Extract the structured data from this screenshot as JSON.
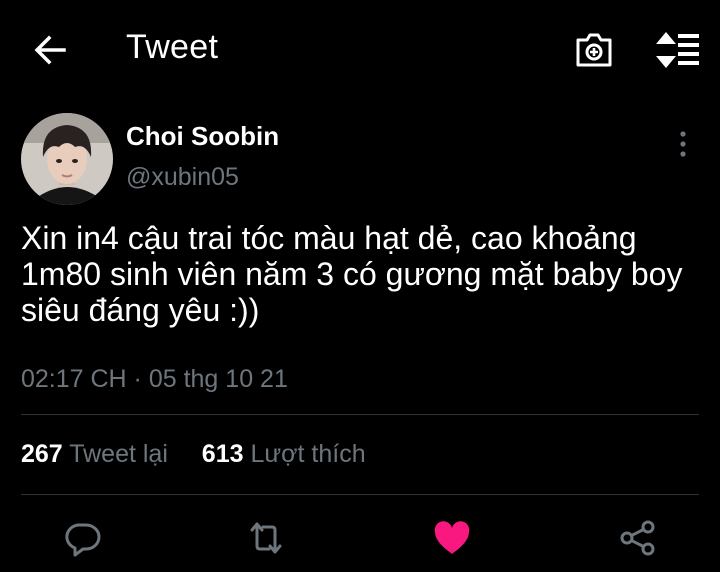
{
  "header": {
    "title": "Tweet",
    "icons": {
      "back": "arrow-left-icon",
      "camera": "camera-icon",
      "sort": "sort-icon"
    }
  },
  "author": {
    "display_name": "Choi Soobin",
    "handle": "@xubin05"
  },
  "tweet": {
    "text": "Xin in4 cậu trai tóc màu hạt dẻ, cao khoảng 1m80 sinh viên năm 3 có gương mặt baby boy siêu đáng yêu :))",
    "timestamp": "02:17 CH · 05 thg 10 21"
  },
  "stats": {
    "retweets_count": "267",
    "retweets_label": "Tweet lại",
    "likes_count": "613",
    "likes_label": "Lượt thích"
  },
  "actions": {
    "icons": [
      "reply-icon",
      "retweet-icon",
      "like-icon",
      "share-icon"
    ],
    "like_active": true,
    "like_color": "#f91880"
  },
  "colors": {
    "background": "#000000",
    "text_primary": "#ffffff",
    "text_secondary": "#6e767d",
    "divider": "#2f3336"
  }
}
